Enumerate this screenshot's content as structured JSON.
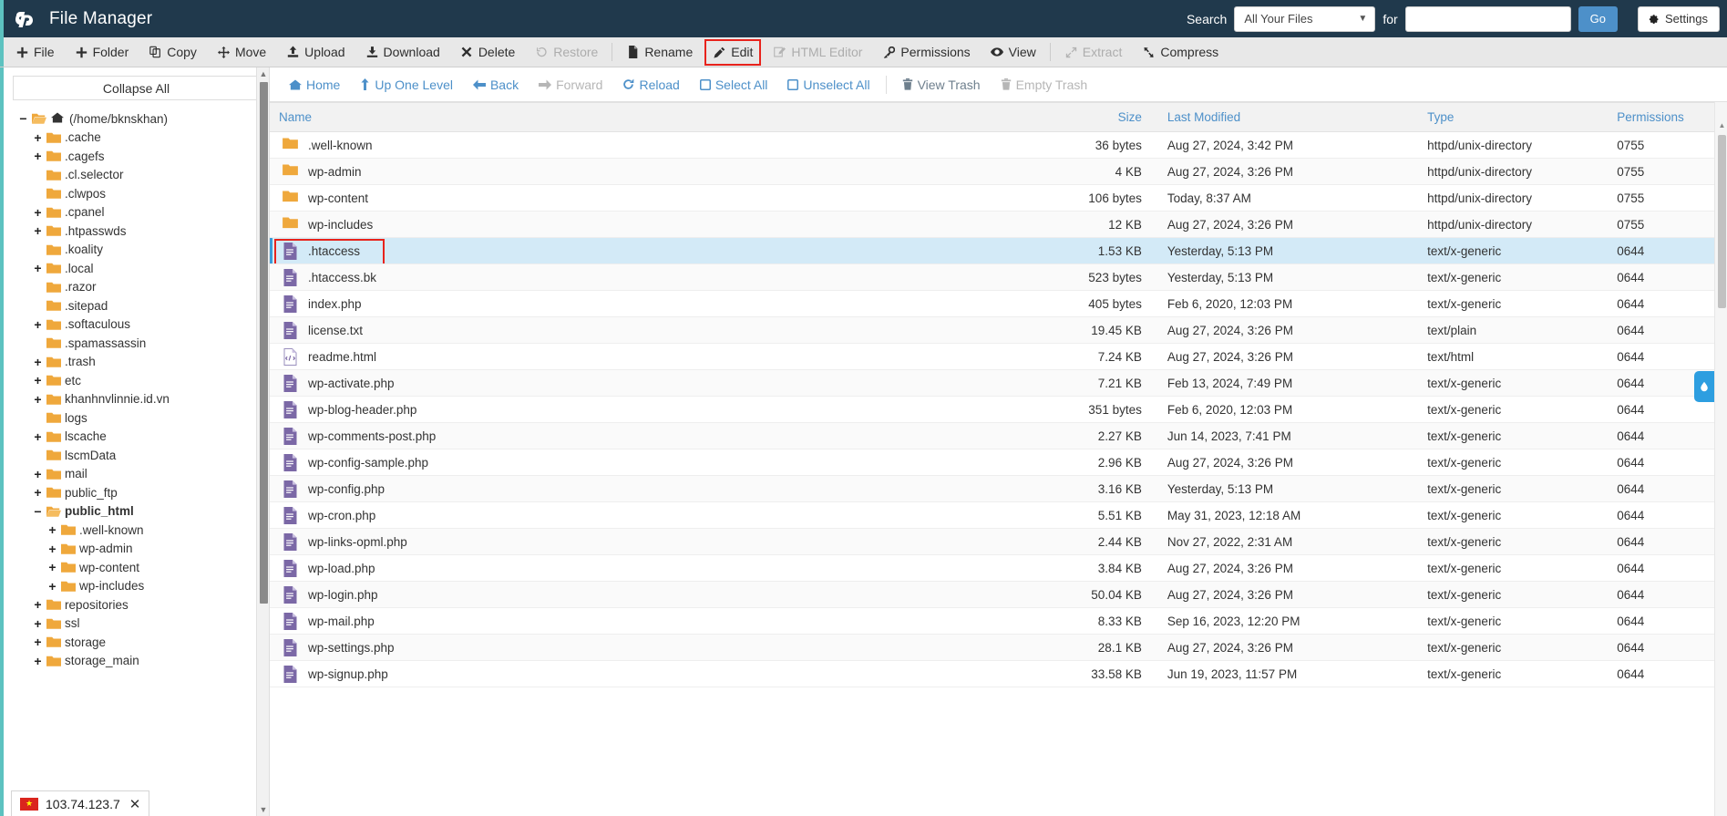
{
  "header": {
    "app_title": "File Manager",
    "logo_icon": "cpanel-logo-icon",
    "search_label": "Search",
    "search_scope_value": "All Your Files",
    "search_for_label": "for",
    "search_input_value": "",
    "search_input_placeholder": "",
    "go_label": "Go",
    "settings_label": "Settings",
    "settings_icon": "gear-icon",
    "accent_color": "#5dc2c0",
    "header_bg": "#20394c",
    "primary_button_color": "#4d90c9"
  },
  "toolbar": {
    "items": [
      {
        "label": "File",
        "icon": "plus-icon",
        "disabled": false,
        "highlight": false,
        "sep_after": false
      },
      {
        "label": "Folder",
        "icon": "plus-icon",
        "disabled": false,
        "highlight": false,
        "sep_after": false
      },
      {
        "label": "Copy",
        "icon": "copy-icon",
        "disabled": false,
        "highlight": false,
        "sep_after": false
      },
      {
        "label": "Move",
        "icon": "move-icon",
        "disabled": false,
        "highlight": false,
        "sep_after": false
      },
      {
        "label": "Upload",
        "icon": "upload-icon",
        "disabled": false,
        "highlight": false,
        "sep_after": false
      },
      {
        "label": "Download",
        "icon": "download-icon",
        "disabled": false,
        "highlight": false,
        "sep_after": false
      },
      {
        "label": "Delete",
        "icon": "x-icon",
        "disabled": false,
        "highlight": false,
        "sep_after": false
      },
      {
        "label": "Restore",
        "icon": "restore-icon",
        "disabled": true,
        "highlight": false,
        "sep_after": true
      },
      {
        "label": "Rename",
        "icon": "file-icon",
        "disabled": false,
        "highlight": false,
        "sep_after": false
      },
      {
        "label": "Edit",
        "icon": "pencil-icon",
        "disabled": false,
        "highlight": true,
        "sep_after": false
      },
      {
        "label": "HTML Editor",
        "icon": "html-editor-icon",
        "disabled": true,
        "highlight": false,
        "sep_after": false
      },
      {
        "label": "Permissions",
        "icon": "key-icon",
        "disabled": false,
        "highlight": false,
        "sep_after": false
      },
      {
        "label": "View",
        "icon": "eye-icon",
        "disabled": false,
        "highlight": false,
        "sep_after": true
      },
      {
        "label": "Extract",
        "icon": "extract-icon",
        "disabled": true,
        "highlight": false,
        "sep_after": false
      },
      {
        "label": "Compress",
        "icon": "compress-icon",
        "disabled": false,
        "highlight": false,
        "sep_after": false
      }
    ]
  },
  "sidebar": {
    "collapse_all_label": "Collapse All",
    "tree": [
      {
        "label": "(/home/bknskhan)",
        "depth": 0,
        "expander": "minus",
        "icon": "folder-open-icon",
        "home": true,
        "selected": false
      },
      {
        "label": ".cache",
        "depth": 1,
        "expander": "plus",
        "icon": "folder-icon",
        "home": false,
        "selected": false
      },
      {
        "label": ".cagefs",
        "depth": 1,
        "expander": "plus",
        "icon": "folder-icon",
        "home": false,
        "selected": false
      },
      {
        "label": ".cl.selector",
        "depth": 1,
        "expander": "none",
        "icon": "folder-icon",
        "home": false,
        "selected": false
      },
      {
        "label": ".clwpos",
        "depth": 1,
        "expander": "none",
        "icon": "folder-icon",
        "home": false,
        "selected": false
      },
      {
        "label": ".cpanel",
        "depth": 1,
        "expander": "plus",
        "icon": "folder-icon",
        "home": false,
        "selected": false
      },
      {
        "label": ".htpasswds",
        "depth": 1,
        "expander": "plus",
        "icon": "folder-icon",
        "home": false,
        "selected": false
      },
      {
        "label": ".koality",
        "depth": 1,
        "expander": "none",
        "icon": "folder-icon",
        "home": false,
        "selected": false
      },
      {
        "label": ".local",
        "depth": 1,
        "expander": "plus",
        "icon": "folder-icon",
        "home": false,
        "selected": false
      },
      {
        "label": ".razor",
        "depth": 1,
        "expander": "none",
        "icon": "folder-icon",
        "home": false,
        "selected": false
      },
      {
        "label": ".sitepad",
        "depth": 1,
        "expander": "none",
        "icon": "folder-icon",
        "home": false,
        "selected": false
      },
      {
        "label": ".softaculous",
        "depth": 1,
        "expander": "plus",
        "icon": "folder-icon",
        "home": false,
        "selected": false
      },
      {
        "label": ".spamassassin",
        "depth": 1,
        "expander": "none",
        "icon": "folder-icon",
        "home": false,
        "selected": false
      },
      {
        "label": ".trash",
        "depth": 1,
        "expander": "plus",
        "icon": "folder-icon",
        "home": false,
        "selected": false
      },
      {
        "label": "etc",
        "depth": 1,
        "expander": "plus",
        "icon": "folder-icon",
        "home": false,
        "selected": false
      },
      {
        "label": "khanhnvlinnie.id.vn",
        "depth": 1,
        "expander": "plus",
        "icon": "folder-icon",
        "home": false,
        "selected": false
      },
      {
        "label": "logs",
        "depth": 1,
        "expander": "none",
        "icon": "folder-icon",
        "home": false,
        "selected": false
      },
      {
        "label": "lscache",
        "depth": 1,
        "expander": "plus",
        "icon": "folder-icon",
        "home": false,
        "selected": false
      },
      {
        "label": "lscmData",
        "depth": 1,
        "expander": "none",
        "icon": "folder-icon",
        "home": false,
        "selected": false
      },
      {
        "label": "mail",
        "depth": 1,
        "expander": "plus",
        "icon": "folder-icon",
        "home": false,
        "selected": false
      },
      {
        "label": "public_ftp",
        "depth": 1,
        "expander": "plus",
        "icon": "folder-icon",
        "home": false,
        "selected": false
      },
      {
        "label": "public_html",
        "depth": 1,
        "expander": "minus",
        "icon": "folder-open-icon",
        "home": false,
        "selected": true
      },
      {
        "label": ".well-known",
        "depth": 2,
        "expander": "plus",
        "icon": "folder-icon",
        "home": false,
        "selected": false
      },
      {
        "label": "wp-admin",
        "depth": 2,
        "expander": "plus",
        "icon": "folder-icon",
        "home": false,
        "selected": false
      },
      {
        "label": "wp-content",
        "depth": 2,
        "expander": "plus",
        "icon": "folder-icon",
        "home": false,
        "selected": false
      },
      {
        "label": "wp-includes",
        "depth": 2,
        "expander": "plus",
        "icon": "folder-icon",
        "home": false,
        "selected": false
      },
      {
        "label": "repositories",
        "depth": 1,
        "expander": "plus",
        "icon": "folder-icon",
        "home": false,
        "selected": false
      },
      {
        "label": "ssl",
        "depth": 1,
        "expander": "plus",
        "icon": "folder-icon",
        "home": false,
        "selected": false
      },
      {
        "label": "storage",
        "depth": 1,
        "expander": "plus",
        "icon": "folder-icon",
        "home": false,
        "selected": false
      },
      {
        "label": "storage_main",
        "depth": 1,
        "expander": "plus",
        "icon": "folder-icon",
        "home": false,
        "selected": false
      }
    ],
    "ip_widget": {
      "ip": "103.74.123.7",
      "flag_icon": "vietnam-flag-icon",
      "close_icon": "close-icon"
    }
  },
  "navbar": {
    "items": [
      {
        "label": "Home",
        "icon": "home-icon",
        "disabled": false,
        "muted": false,
        "sep_after": false
      },
      {
        "label": "Up One Level",
        "icon": "up-arrow-icon",
        "disabled": false,
        "muted": false,
        "sep_after": false
      },
      {
        "label": "Back",
        "icon": "left-arrow-icon",
        "disabled": false,
        "muted": false,
        "sep_after": false
      },
      {
        "label": "Forward",
        "icon": "right-arrow-icon",
        "disabled": true,
        "muted": false,
        "sep_after": false
      },
      {
        "label": "Reload",
        "icon": "reload-icon",
        "disabled": false,
        "muted": false,
        "sep_after": false
      },
      {
        "label": "Select All",
        "icon": "checkbox-icon",
        "disabled": false,
        "muted": false,
        "sep_after": false
      },
      {
        "label": "Unselect All",
        "icon": "checkbox-icon",
        "disabled": false,
        "muted": false,
        "sep_after": true
      },
      {
        "label": "View Trash",
        "icon": "trash-icon",
        "disabled": false,
        "muted": true,
        "sep_after": false
      },
      {
        "label": "Empty Trash",
        "icon": "trash-icon",
        "disabled": true,
        "muted": false,
        "sep_after": false
      }
    ]
  },
  "file_table": {
    "columns": [
      "Name",
      "Size",
      "Last Modified",
      "Type",
      "Permissions"
    ],
    "rows": [
      {
        "name": ".well-known",
        "icon": "folder-icon",
        "size": "36 bytes",
        "modified": "Aug 27, 2024, 3:42 PM",
        "type": "httpd/unix-directory",
        "permissions": "0755",
        "selected": false,
        "annotated": false
      },
      {
        "name": "wp-admin",
        "icon": "folder-icon",
        "size": "4 KB",
        "modified": "Aug 27, 2024, 3:26 PM",
        "type": "httpd/unix-directory",
        "permissions": "0755",
        "selected": false,
        "annotated": false
      },
      {
        "name": "wp-content",
        "icon": "folder-icon",
        "size": "106 bytes",
        "modified": "Today, 8:37 AM",
        "type": "httpd/unix-directory",
        "permissions": "0755",
        "selected": false,
        "annotated": false
      },
      {
        "name": "wp-includes",
        "icon": "folder-icon",
        "size": "12 KB",
        "modified": "Aug 27, 2024, 3:26 PM",
        "type": "httpd/unix-directory",
        "permissions": "0755",
        "selected": false,
        "annotated": false
      },
      {
        "name": ".htaccess",
        "icon": "text-file-icon",
        "size": "1.53 KB",
        "modified": "Yesterday, 5:13 PM",
        "type": "text/x-generic",
        "permissions": "0644",
        "selected": true,
        "annotated": true
      },
      {
        "name": ".htaccess.bk",
        "icon": "text-file-icon",
        "size": "523 bytes",
        "modified": "Yesterday, 5:13 PM",
        "type": "text/x-generic",
        "permissions": "0644",
        "selected": false,
        "annotated": false
      },
      {
        "name": "index.php",
        "icon": "text-file-icon",
        "size": "405 bytes",
        "modified": "Feb 6, 2020, 12:03 PM",
        "type": "text/x-generic",
        "permissions": "0644",
        "selected": false,
        "annotated": false
      },
      {
        "name": "license.txt",
        "icon": "text-file-icon",
        "size": "19.45 KB",
        "modified": "Aug 27, 2024, 3:26 PM",
        "type": "text/plain",
        "permissions": "0644",
        "selected": false,
        "annotated": false
      },
      {
        "name": "readme.html",
        "icon": "html-file-icon",
        "size": "7.24 KB",
        "modified": "Aug 27, 2024, 3:26 PM",
        "type": "text/html",
        "permissions": "0644",
        "selected": false,
        "annotated": false
      },
      {
        "name": "wp-activate.php",
        "icon": "text-file-icon",
        "size": "7.21 KB",
        "modified": "Feb 13, 2024, 7:49 PM",
        "type": "text/x-generic",
        "permissions": "0644",
        "selected": false,
        "annotated": false
      },
      {
        "name": "wp-blog-header.php",
        "icon": "text-file-icon",
        "size": "351 bytes",
        "modified": "Feb 6, 2020, 12:03 PM",
        "type": "text/x-generic",
        "permissions": "0644",
        "selected": false,
        "annotated": false
      },
      {
        "name": "wp-comments-post.php",
        "icon": "text-file-icon",
        "size": "2.27 KB",
        "modified": "Jun 14, 2023, 7:41 PM",
        "type": "text/x-generic",
        "permissions": "0644",
        "selected": false,
        "annotated": false
      },
      {
        "name": "wp-config-sample.php",
        "icon": "text-file-icon",
        "size": "2.96 KB",
        "modified": "Aug 27, 2024, 3:26 PM",
        "type": "text/x-generic",
        "permissions": "0644",
        "selected": false,
        "annotated": false
      },
      {
        "name": "wp-config.php",
        "icon": "text-file-icon",
        "size": "3.16 KB",
        "modified": "Yesterday, 5:13 PM",
        "type": "text/x-generic",
        "permissions": "0644",
        "selected": false,
        "annotated": false
      },
      {
        "name": "wp-cron.php",
        "icon": "text-file-icon",
        "size": "5.51 KB",
        "modified": "May 31, 2023, 12:18 AM",
        "type": "text/x-generic",
        "permissions": "0644",
        "selected": false,
        "annotated": false
      },
      {
        "name": "wp-links-opml.php",
        "icon": "text-file-icon",
        "size": "2.44 KB",
        "modified": "Nov 27, 2022, 2:31 AM",
        "type": "text/x-generic",
        "permissions": "0644",
        "selected": false,
        "annotated": false
      },
      {
        "name": "wp-load.php",
        "icon": "text-file-icon",
        "size": "3.84 KB",
        "modified": "Aug 27, 2024, 3:26 PM",
        "type": "text/x-generic",
        "permissions": "0644",
        "selected": false,
        "annotated": false
      },
      {
        "name": "wp-login.php",
        "icon": "text-file-icon",
        "size": "50.04 KB",
        "modified": "Aug 27, 2024, 3:26 PM",
        "type": "text/x-generic",
        "permissions": "0644",
        "selected": false,
        "annotated": false
      },
      {
        "name": "wp-mail.php",
        "icon": "text-file-icon",
        "size": "8.33 KB",
        "modified": "Sep 16, 2023, 12:20 PM",
        "type": "text/x-generic",
        "permissions": "0644",
        "selected": false,
        "annotated": false
      },
      {
        "name": "wp-settings.php",
        "icon": "text-file-icon",
        "size": "28.1 KB",
        "modified": "Aug 27, 2024, 3:26 PM",
        "type": "text/x-generic",
        "permissions": "0644",
        "selected": false,
        "annotated": false
      },
      {
        "name": "wp-signup.php",
        "icon": "text-file-icon",
        "size": "33.58 KB",
        "modified": "Jun 19, 2023, 11:57 PM",
        "type": "text/x-generic",
        "permissions": "0644",
        "selected": false,
        "annotated": false
      }
    ]
  }
}
